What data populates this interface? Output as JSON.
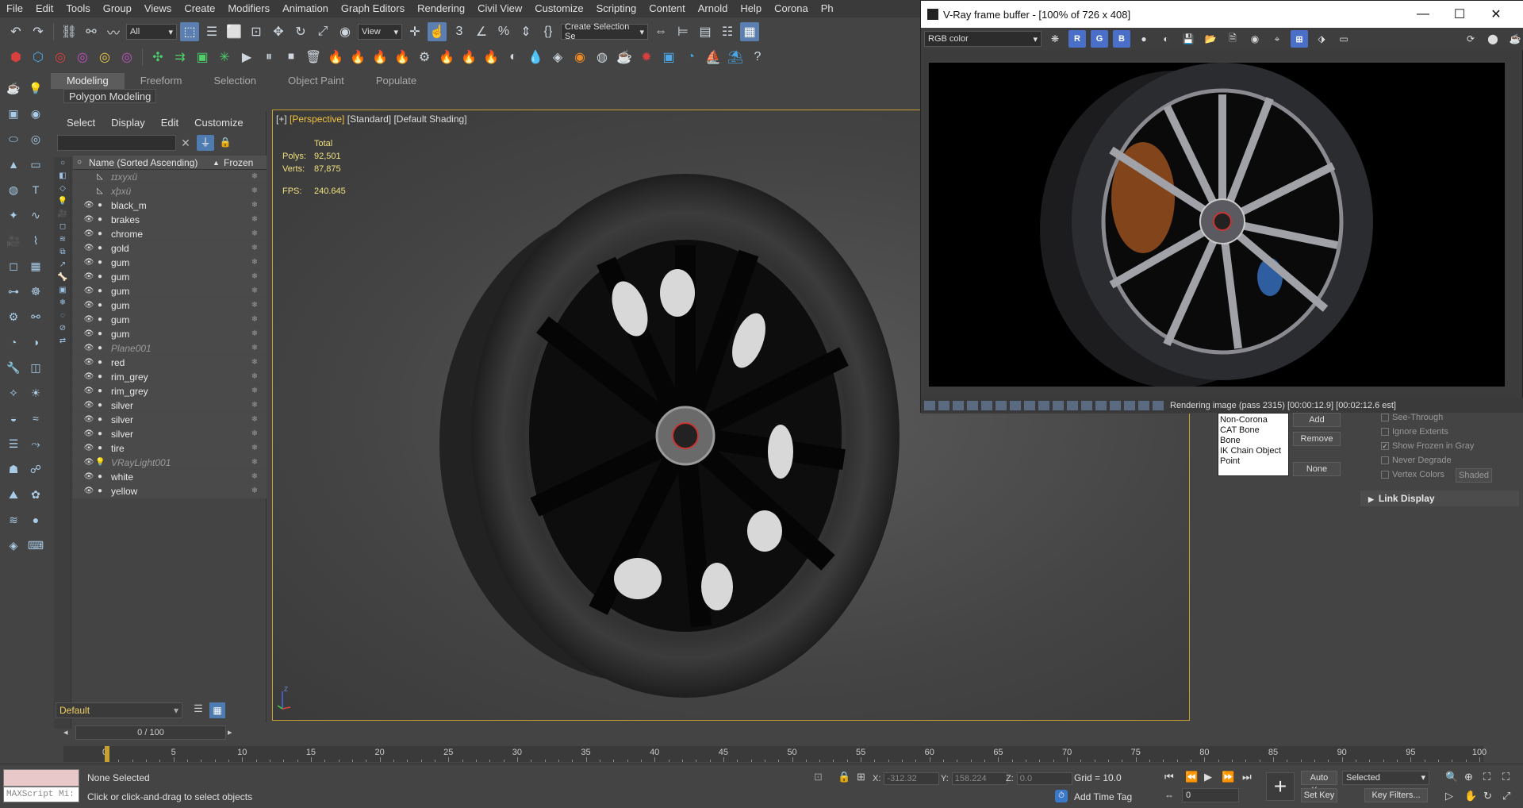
{
  "menu": [
    "File",
    "Edit",
    "Tools",
    "Group",
    "Views",
    "Create",
    "Modifiers",
    "Animation",
    "Graph Editors",
    "Rendering",
    "Civil View",
    "Customize",
    "Scripting",
    "Content",
    "Arnold",
    "Help",
    "Corona",
    "Ph"
  ],
  "toolbar": {
    "selection_filter": "All",
    "ref_coord": "View",
    "named_selection": "Create Selection Se"
  },
  "ribbon": {
    "tabs": [
      "Modeling",
      "Freeform",
      "Selection",
      "Object Paint",
      "Populate"
    ],
    "active_tab": "Modeling",
    "sub_panel": "Polygon Modeling"
  },
  "explorer": {
    "menu": [
      "Select",
      "Display",
      "Edit",
      "Customize"
    ],
    "col_name": "Name (Sorted Ascending)",
    "col_frozen": "Frozen",
    "rows": [
      {
        "name": "ɪɪxyxü",
        "dim": true,
        "icon": "helper"
      },
      {
        "name": "xþxü",
        "dim": true,
        "icon": "helper"
      },
      {
        "name": "black_m",
        "dim": false,
        "icon": "geo"
      },
      {
        "name": "brakes",
        "dim": false,
        "icon": "geo"
      },
      {
        "name": "chrome",
        "dim": false,
        "icon": "geo"
      },
      {
        "name": "gold",
        "dim": false,
        "icon": "geo"
      },
      {
        "name": "gum",
        "dim": false,
        "icon": "geo"
      },
      {
        "name": "gum",
        "dim": false,
        "icon": "geo"
      },
      {
        "name": "gum",
        "dim": false,
        "icon": "geo"
      },
      {
        "name": "gum",
        "dim": false,
        "icon": "geo"
      },
      {
        "name": "gum",
        "dim": false,
        "icon": "geo"
      },
      {
        "name": "gum",
        "dim": false,
        "icon": "geo"
      },
      {
        "name": "Plane001",
        "dim": true,
        "icon": "geo"
      },
      {
        "name": "red",
        "dim": false,
        "icon": "geo"
      },
      {
        "name": "rim_grey",
        "dim": false,
        "icon": "geo"
      },
      {
        "name": "rim_grey",
        "dim": false,
        "icon": "geo"
      },
      {
        "name": "silver",
        "dim": false,
        "icon": "geo"
      },
      {
        "name": "silver",
        "dim": false,
        "icon": "geo"
      },
      {
        "name": "silver",
        "dim": false,
        "icon": "geo"
      },
      {
        "name": "tire",
        "dim": false,
        "icon": "geo"
      },
      {
        "name": "VRayLight001",
        "dim": true,
        "icon": "light"
      },
      {
        "name": "white",
        "dim": false,
        "icon": "geo"
      },
      {
        "name": "yellow",
        "dim": false,
        "icon": "geo"
      }
    ],
    "layer": "Default",
    "frame_range": "0 / 100"
  },
  "viewport": {
    "label_plus": "[+]",
    "label_view": "[Perspective]",
    "label_style": "[Standard]",
    "label_shading": "[Default Shading]",
    "stats_total": "Total",
    "polys_label": "Polys:",
    "polys": "92,501",
    "verts_label": "Verts:",
    "verts": "87,875",
    "fps_label": "FPS:",
    "fps": "240.645"
  },
  "vfb": {
    "title": "V-Ray frame buffer - [100% of 726 x 408]",
    "channel": "RGB color",
    "status": "Rendering image (pass 2315) [00:00:12.9] [00:02:12.6 est]"
  },
  "command_panel": {
    "list": [
      "Non-Corona",
      "CAT Bone",
      "Bone",
      "IK Chain Object",
      "Point"
    ],
    "add": "Add",
    "remove": "Remove",
    "none": "None",
    "see_through": "See-Through",
    "ignore_extents": "Ignore Extents",
    "show_frozen_gray": "Show Frozen in Gray",
    "never_degrade": "Never Degrade",
    "vertex_colors": "Vertex Colors",
    "shaded": "Shaded",
    "link_display": "Link Display"
  },
  "timeline": {
    "ticks": [
      "0",
      "5",
      "10",
      "15",
      "20",
      "25",
      "30",
      "35",
      "40",
      "45",
      "50",
      "55",
      "60",
      "65",
      "70",
      "75",
      "80",
      "85",
      "90",
      "95",
      "100"
    ]
  },
  "status": {
    "maxscript": "MAXScript Mi:",
    "selection": "None Selected",
    "prompt": "Click or click-and-drag to select objects",
    "x_label": "X:",
    "x": "-312.32",
    "y_label": "Y:",
    "y": "158.224",
    "z_label": "Z:",
    "z": "0.0",
    "grid": "Grid = 10.0",
    "add_time_tag": "Add Time Tag",
    "auto_key": "Auto Key",
    "set_key": "Set Key",
    "key_mode": "Selected",
    "key_filters": "Key Filters...",
    "frame": "0"
  },
  "colors": {
    "accent": "#c8a030",
    "viewport_bg": "#4a4a4a",
    "active_tool": "#5a7fb0"
  }
}
